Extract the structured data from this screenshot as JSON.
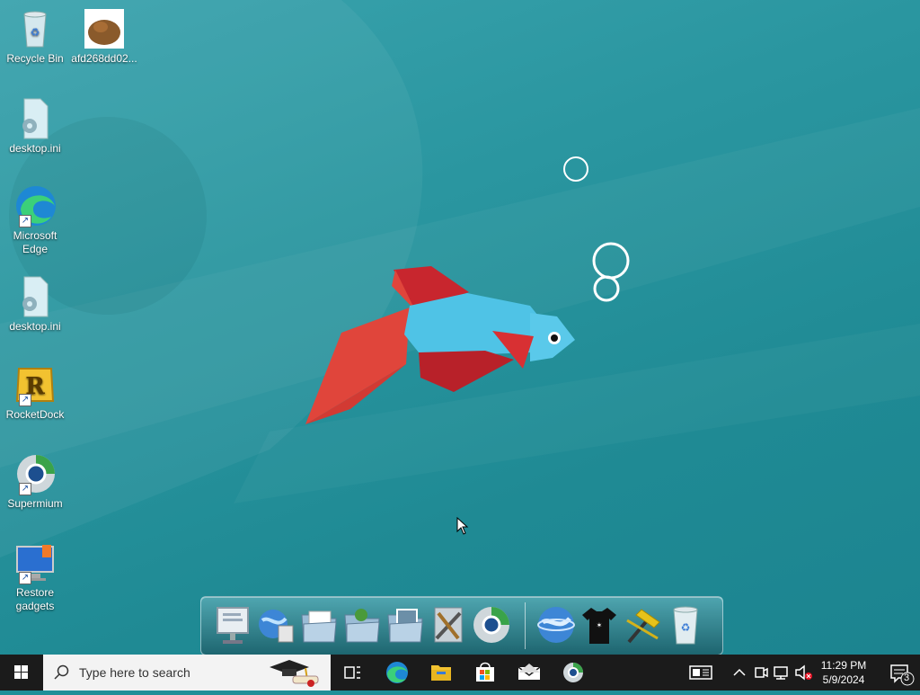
{
  "desktop": {
    "icons": [
      {
        "label": "Recycle Bin",
        "icon": "recycle-bin-icon"
      },
      {
        "label": "afd268dd02...",
        "icon": "image-thumbnail-icon"
      },
      {
        "label": "desktop.ini",
        "icon": "settings-file-icon"
      },
      {
        "label": "Microsoft Edge",
        "icon": "edge-icon"
      },
      {
        "label": "desktop.ini",
        "icon": "settings-file-icon"
      },
      {
        "label": "RocketDock",
        "icon": "rocketdock-icon"
      },
      {
        "label": "Supermium",
        "icon": "supermium-icon"
      },
      {
        "label": "Restore gadgets",
        "icon": "restore-gadgets-icon"
      }
    ]
  },
  "dock": {
    "items": [
      {
        "icon": "monitor-icon"
      },
      {
        "icon": "globe-network-icon"
      },
      {
        "icon": "documents-folder-icon"
      },
      {
        "icon": "network-folder-icon"
      },
      {
        "icon": "pictures-folder-icon"
      },
      {
        "icon": "tools-icon"
      },
      {
        "icon": "supermium-icon"
      },
      {
        "icon": "globe-icon"
      },
      {
        "icon": "tshirt-icon"
      },
      {
        "icon": "hammer-icon"
      },
      {
        "icon": "recycle-bin-icon"
      }
    ]
  },
  "taskbar": {
    "search_placeholder": "Type here to search",
    "clock_time": "11:29 PM",
    "clock_date": "5/9/2024",
    "notification_count": "3",
    "pinned": [
      "task-view-icon",
      "edge-icon",
      "file-explorer-icon",
      "store-icon",
      "mail-icon",
      "supermium-icon"
    ]
  },
  "colors": {
    "wallpaper": "#2a96a0",
    "taskbar": "#1b1b1b",
    "fish_body": "#4fc3e6",
    "fish_fin": "#c8262e",
    "fish_tail": "#e0453b"
  }
}
